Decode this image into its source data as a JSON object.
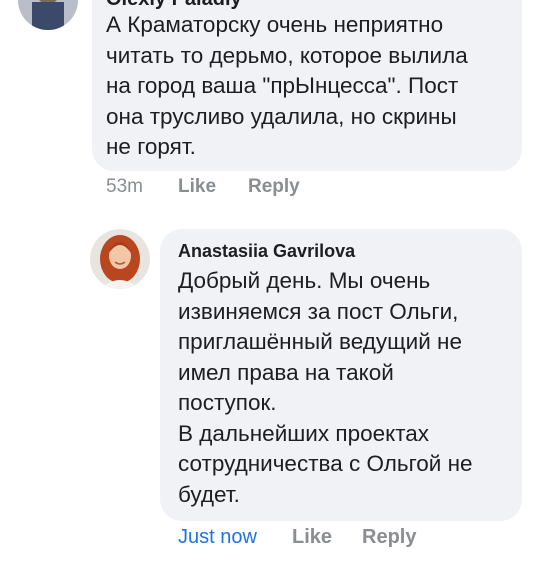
{
  "comments": [
    {
      "author": "Olexiy Paladiy",
      "text": "А Краматорску очень неприятно\nчитать то дерьмо, которое вылила\nна город ваша \"прЫнцесса\". Пост\nона трусливо удалила, но скрины\nне горят.",
      "time": "53m",
      "like_label": "Like",
      "reply_label": "Reply"
    },
    {
      "author": "Anastasiia Gavrilova",
      "text": "Добрый день. Мы очень\nизвиняемся за пост Ольги,\nприглашённый ведущий не\nимел права на такой\nпоступок.\nВ дальнейших проектах\nсотрудничества с Ольгой не\nбудет.",
      "time": "Just now",
      "like_label": "Like",
      "reply_label": "Reply"
    }
  ],
  "colors": {
    "bubble": "#f0f2f5",
    "text": "#1c1e21",
    "muted": "#8a8d91",
    "link": "#1b74e4"
  }
}
